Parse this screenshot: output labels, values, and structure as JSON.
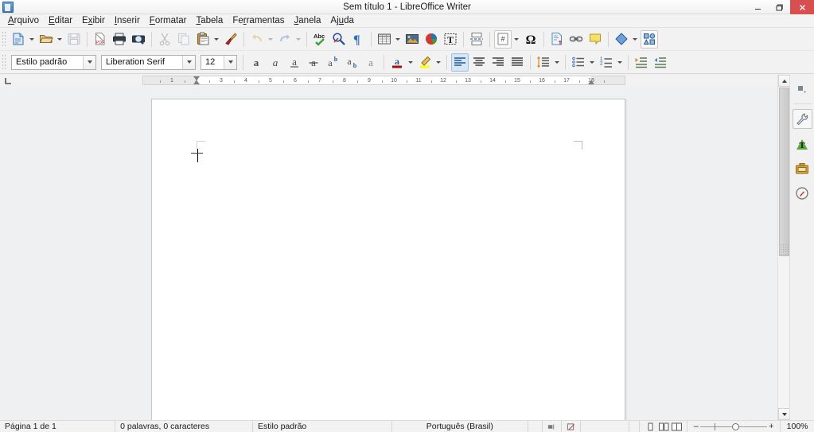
{
  "window": {
    "title": "Sem título 1 - LibreOffice Writer",
    "app_icon": "writer-document-icon",
    "controls": {
      "minimize": "minimize-icon",
      "restore": "restore-icon",
      "close": "close-icon"
    }
  },
  "menubar": {
    "items": [
      {
        "label": "Arquivo",
        "accel": "A"
      },
      {
        "label": "Editar",
        "accel": "E"
      },
      {
        "label": "Exibir",
        "accel": "x"
      },
      {
        "label": "Inserir",
        "accel": "I"
      },
      {
        "label": "Formatar",
        "accel": "F"
      },
      {
        "label": "Tabela",
        "accel": "T"
      },
      {
        "label": "Ferramentas",
        "accel": "r"
      },
      {
        "label": "Janela",
        "accel": "J"
      },
      {
        "label": "Ajuda",
        "accel": "u"
      }
    ]
  },
  "toolbar_standard": {
    "items": [
      {
        "name": "new-document-button",
        "icon": "new-document-icon",
        "dropdown": true,
        "enabled": true
      },
      {
        "name": "open-button",
        "icon": "open-folder-icon",
        "dropdown": true,
        "enabled": true
      },
      {
        "name": "save-button",
        "icon": "save-floppy-icon",
        "dropdown": false,
        "enabled": false
      },
      {
        "name": "export-pdf-button",
        "icon": "export-pdf-icon",
        "dropdown": false,
        "enabled": true
      },
      {
        "name": "print-button",
        "icon": "printer-icon",
        "dropdown": false,
        "enabled": true
      },
      {
        "name": "print-preview-button",
        "icon": "print-preview-icon",
        "dropdown": false,
        "enabled": true
      },
      {
        "name": "cut-button",
        "icon": "scissors-icon",
        "dropdown": false,
        "enabled": false
      },
      {
        "name": "copy-button",
        "icon": "copy-icon",
        "dropdown": false,
        "enabled": false
      },
      {
        "name": "paste-button",
        "icon": "clipboard-icon",
        "dropdown": true,
        "enabled": true
      },
      {
        "name": "clone-formatting-button",
        "icon": "paintbrush-icon",
        "dropdown": false,
        "enabled": true
      },
      {
        "name": "undo-button",
        "icon": "undo-arrow-icon",
        "dropdown": true,
        "enabled": false
      },
      {
        "name": "redo-button",
        "icon": "redo-arrow-icon",
        "dropdown": true,
        "enabled": false
      },
      {
        "name": "spelling-button",
        "icon": "spellcheck-abc-icon",
        "dropdown": false,
        "enabled": true
      },
      {
        "name": "find-replace-button",
        "icon": "find-replace-icon",
        "dropdown": false,
        "enabled": true
      },
      {
        "name": "formatting-marks-button",
        "icon": "pilcrow-icon",
        "dropdown": false,
        "enabled": true
      },
      {
        "name": "insert-table-button",
        "icon": "table-grid-icon",
        "dropdown": true,
        "enabled": true
      },
      {
        "name": "insert-image-button",
        "icon": "image-icon",
        "dropdown": false,
        "enabled": true
      },
      {
        "name": "insert-chart-button",
        "icon": "pie-chart-icon",
        "dropdown": false,
        "enabled": true
      },
      {
        "name": "insert-text-box-button",
        "icon": "text-box-icon",
        "dropdown": false,
        "enabled": true
      },
      {
        "name": "page-break-button",
        "icon": "page-break-icon",
        "dropdown": false,
        "enabled": true
      },
      {
        "name": "insert-field-button",
        "icon": "field-hash-icon",
        "dropdown": true,
        "enabled": true
      },
      {
        "name": "special-character-button",
        "icon": "omega-icon",
        "dropdown": false,
        "enabled": true
      },
      {
        "name": "insert-footnote-button",
        "icon": "footnote-icon",
        "dropdown": false,
        "enabled": true
      },
      {
        "name": "insert-hyperlink-button",
        "icon": "hyperlink-chain-icon",
        "dropdown": false,
        "enabled": true
      },
      {
        "name": "insert-comment-button",
        "icon": "sticky-note-icon",
        "dropdown": false,
        "enabled": true
      },
      {
        "name": "basic-shapes-button",
        "icon": "diamond-shape-icon",
        "dropdown": true,
        "enabled": true
      },
      {
        "name": "show-draw-functions-button",
        "icon": "draw-functions-icon",
        "dropdown": false,
        "enabled": true
      }
    ]
  },
  "toolbar_formatting": {
    "paragraph_style": {
      "value": "Estilo padrão",
      "placeholder": "Estilo padrão"
    },
    "font_name": {
      "value": "Liberation Serif",
      "placeholder": "Liberation Serif"
    },
    "font_size": {
      "value": "12",
      "placeholder": "12"
    },
    "items": [
      {
        "name": "bold-button",
        "icon": "bold-a-icon",
        "active": false
      },
      {
        "name": "italic-button",
        "icon": "italic-a-icon",
        "active": false
      },
      {
        "name": "underline-button",
        "icon": "underline-a-icon",
        "active": false
      },
      {
        "name": "strikethrough-button",
        "icon": "strikethrough-a-icon",
        "active": false
      },
      {
        "name": "superscript-button",
        "icon": "superscript-icon",
        "active": false
      },
      {
        "name": "subscript-button",
        "icon": "subscript-icon",
        "active": false
      },
      {
        "name": "clear-formatting-button",
        "icon": "clear-formatting-icon",
        "active": false
      },
      {
        "name": "font-color-button",
        "icon": "font-color-icon",
        "active": false,
        "dropdown": true,
        "color": "#a01010"
      },
      {
        "name": "highlight-color-button",
        "icon": "highlight-icon",
        "active": false,
        "dropdown": true,
        "color": "#ffff00"
      },
      {
        "name": "align-left-button",
        "icon": "align-left-icon",
        "active": true
      },
      {
        "name": "align-center-button",
        "icon": "align-center-icon",
        "active": false
      },
      {
        "name": "align-right-button",
        "icon": "align-right-icon",
        "active": false
      },
      {
        "name": "align-justified-button",
        "icon": "align-justify-icon",
        "active": false
      },
      {
        "name": "line-spacing-button",
        "icon": "line-spacing-icon",
        "active": false,
        "dropdown": true
      },
      {
        "name": "unordered-list-button",
        "icon": "bullet-list-icon",
        "active": false,
        "dropdown": true
      },
      {
        "name": "ordered-list-button",
        "icon": "numbered-list-icon",
        "active": false,
        "dropdown": true
      },
      {
        "name": "increase-indent-button",
        "icon": "increase-indent-icon",
        "active": false
      },
      {
        "name": "decrease-indent-button",
        "icon": "decrease-indent-icon",
        "active": false
      }
    ]
  },
  "ruler": {
    "tab_selector": "tab-stop-left-icon",
    "numbers": [
      "1",
      "2",
      "3",
      "4",
      "5",
      "6",
      "7",
      "8",
      "9",
      "10",
      "11",
      "12",
      "13",
      "14",
      "15",
      "16",
      "17",
      "18"
    ],
    "left_indent_position": "1",
    "right_indent_position": "17"
  },
  "document": {
    "page_background": "#ffffff",
    "cursor_visible": true,
    "text": ""
  },
  "sidebar": {
    "items": [
      {
        "name": "sidebar-settings-button",
        "icon": "sidebar-settings-icon",
        "selected": false
      },
      {
        "name": "sidebar-properties-button",
        "icon": "wrench-icon",
        "selected": true
      },
      {
        "name": "sidebar-styles-button",
        "icon": "styles-t-icon",
        "selected": false
      },
      {
        "name": "sidebar-gallery-button",
        "icon": "gallery-icon",
        "selected": false
      },
      {
        "name": "sidebar-navigator-button",
        "icon": "navigator-compass-icon",
        "selected": false
      }
    ]
  },
  "scrollbar": {
    "up_arrow": "scroll-up-icon",
    "down_arrow": "scroll-down-icon",
    "split_handle": "split-view-handle"
  },
  "statusbar": {
    "page": "Página 1 de 1",
    "words": "0 palavras, 0 caracteres",
    "style": "Estilo padrão",
    "language": "Português (Brasil)",
    "insert_mode": "",
    "selection_mode_icon": "selection-mode-icon",
    "save_status_icon": "unsaved-changes-icon",
    "digital_signature": "",
    "section": "",
    "view_single_page_icon": "single-page-view-icon",
    "view_multi_page_icon": "multi-page-view-icon",
    "view_book_icon": "book-view-icon",
    "zoom_out_label": "–",
    "zoom_in_label": "+",
    "zoom_level": "100%"
  }
}
